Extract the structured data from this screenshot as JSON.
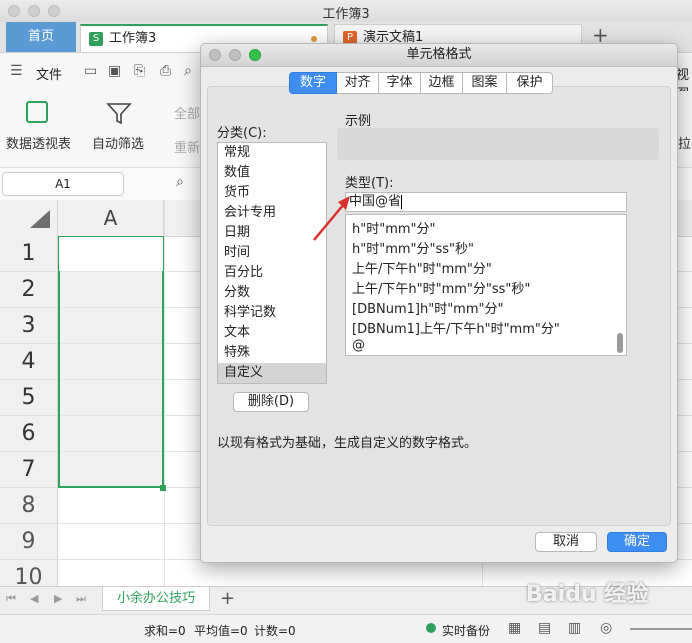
{
  "window": {
    "title": "工作簿3"
  },
  "tabs": {
    "home": "首页",
    "doc1": "工作簿3",
    "doc2": "演示文稿1",
    "add": "+",
    "doc1_icon": "S",
    "doc2_icon": "P"
  },
  "menu": {
    "file": "文件",
    "view_partial": "视图"
  },
  "ribbon": {
    "pivot": "数据透视表",
    "autofilter": "自动筛选",
    "all": "全部",
    "reapply": "重新",
    "right_partial": "拉"
  },
  "formula": {
    "cell_ref": "A1"
  },
  "grid": {
    "column": "A",
    "rows": [
      "1",
      "2",
      "3",
      "4",
      "5",
      "6",
      "7",
      "8",
      "9",
      "10"
    ]
  },
  "sheetbar": {
    "sheet_name": "小余办公技巧",
    "add": "+"
  },
  "status": {
    "sum": "求和=0",
    "avg": "平均值=0",
    "count": "计数=0",
    "backup": "实时备份"
  },
  "dialog": {
    "title": "单元格格式",
    "tabs": [
      "数字",
      "对齐",
      "字体",
      "边框",
      "图案",
      "保护"
    ],
    "selected_tab": "数字",
    "category_label": "分类(C):",
    "categories": [
      "常规",
      "数值",
      "货币",
      "会计专用",
      "日期",
      "时间",
      "百分比",
      "分数",
      "科学记数",
      "文本",
      "特殊",
      "自定义"
    ],
    "selected_category": "自定义",
    "sample_label": "示例",
    "type_label": "类型(T):",
    "type_value": "中国@省",
    "type_list": [
      "h\"时\"mm\"分\"",
      "h\"时\"mm\"分\"ss\"秒\"",
      "上午/下午h\"时\"mm\"分\"",
      "上午/下午h\"时\"mm\"分\"ss\"秒\"",
      "[DBNum1]h\"时\"mm\"分\"",
      "[DBNum1]上午/下午h\"时\"mm\"分\"",
      "@"
    ],
    "delete_button": "删除(D)",
    "description": "以现有格式为基础，生成自定义的数字格式。",
    "cancel": "取消",
    "ok": "确定"
  },
  "watermark": {
    "text": "Baidu 经验"
  },
  "colors": {
    "accent_blue": "#3d8ef0",
    "home_tab": "#5b9bd5",
    "selection_green": "#2ea25b",
    "arrow_red": "#d9302c"
  }
}
